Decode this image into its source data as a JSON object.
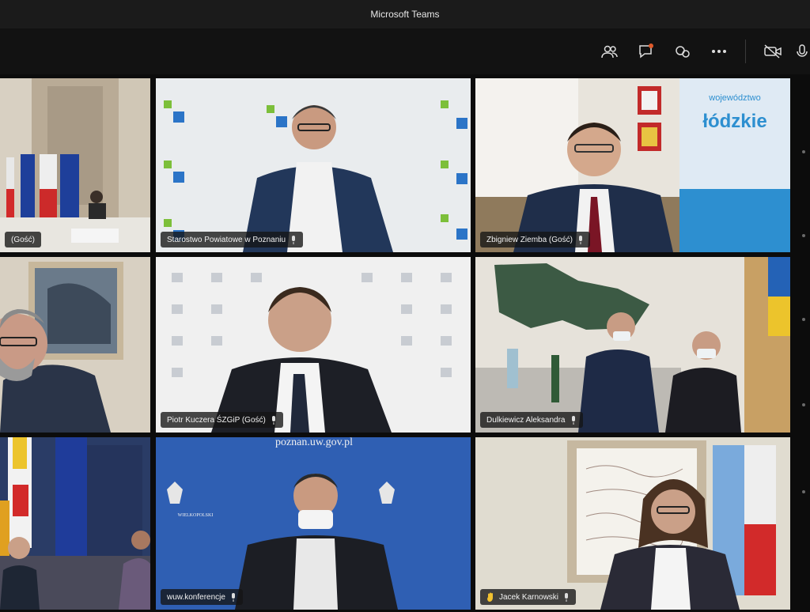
{
  "window": {
    "title": "Microsoft Teams"
  },
  "toolbar": {
    "icons": [
      "participants-icon",
      "chat-icon",
      "reactions-icon",
      "more-icon",
      "camera-off-icon",
      "mic-icon"
    ]
  },
  "tiles": [
    {
      "id": "t1",
      "label": "(Gość)",
      "highlight": "blue"
    },
    {
      "id": "t2",
      "label": "Starostwo Powiatowe w Poznaniu"
    },
    {
      "id": "t3",
      "label": "Zbigniew Ziemba (Gość)"
    },
    {
      "id": "t4",
      "label": "",
      "highlight": "gold"
    },
    {
      "id": "t5",
      "label": "Piotr Kuczera ŚZGiP (Gość)"
    },
    {
      "id": "t6",
      "label": "Dulkiewicz Aleksandra"
    },
    {
      "id": "t7",
      "label": "",
      "highlight": "gold"
    },
    {
      "id": "t8",
      "label": "wuw.konferencje",
      "backdrop_text": "poznan.uw.gov.pl",
      "backdrop_small": "WIELKOPOLSKI"
    },
    {
      "id": "t9",
      "label": "Jacek Karnowski",
      "highlight": "gold",
      "hand_raised": true
    }
  ],
  "backdrops": {
    "t3_banner": "województwo",
    "t3_banner_main": "łódzkie"
  }
}
